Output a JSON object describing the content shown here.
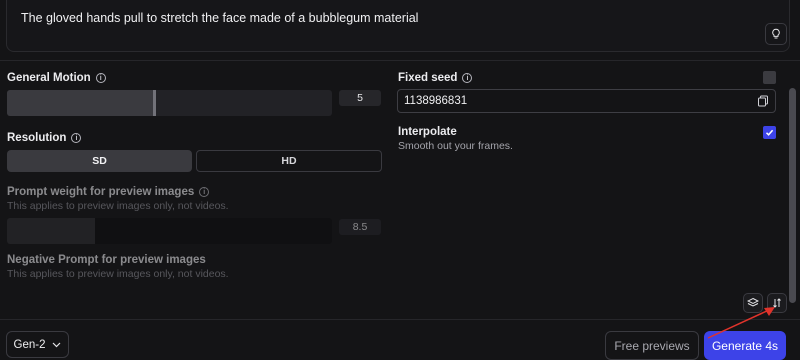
{
  "prompt": {
    "text": "The gloved hands pull to stretch the face made of a bubblegum material",
    "hint_icon": "lightbulb-icon"
  },
  "general_motion": {
    "label": "General Motion",
    "value": "5",
    "level": 0.45
  },
  "resolution": {
    "label": "Resolution",
    "options": [
      "SD",
      "HD"
    ],
    "selected": "SD"
  },
  "prompt_weight": {
    "label": "Prompt weight for preview images",
    "description": "This applies to preview images only, not videos.",
    "value": "8.5",
    "level": 0.27
  },
  "negative_prompt": {
    "label": "Negative Prompt for preview images",
    "description": "This applies to preview images only, not videos."
  },
  "fixed_seed": {
    "label": "Fixed seed",
    "value": "1138986831",
    "checked": false
  },
  "interpolate": {
    "label": "Interpolate",
    "description": "Smooth out your frames.",
    "checked": true
  },
  "footer": {
    "model": "Gen-2",
    "free_previews_label": "Free previews",
    "generate_label": "Generate 4s"
  },
  "colors": {
    "accent": "#3d43e8",
    "annotation_arrow": "#e0332b",
    "background": "#141416"
  }
}
